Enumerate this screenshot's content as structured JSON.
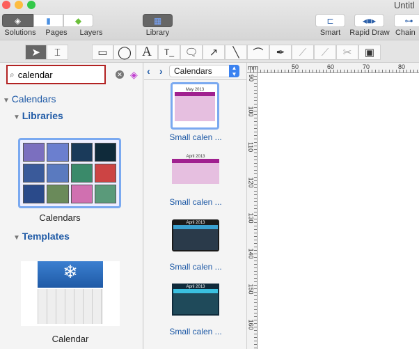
{
  "window": {
    "title": "Untitl"
  },
  "toolbar": {
    "solutions": "Solutions",
    "pages": "Pages",
    "layers": "Layers",
    "library": "Library",
    "smart": "Smart",
    "rapid_draw": "Rapid Draw",
    "chain": "Chain"
  },
  "search": {
    "value": "calendar"
  },
  "tree": {
    "root": "Calendars",
    "libraries": "Libraries",
    "library_item": "Calendars",
    "templates": "Templates",
    "template_item": "Calendar"
  },
  "library_panel": {
    "selected": "Calendars",
    "items": [
      {
        "label": "Small calen ...",
        "month": "May 2013",
        "theme": "#a0208f"
      },
      {
        "label": "Small calen ...",
        "month": "April 2013",
        "theme": "#a0208f"
      },
      {
        "label": "Small calen ...",
        "month": "April 2013",
        "theme": "#1a1a1a"
      },
      {
        "label": "Small calen ...",
        "month": "April 2013",
        "theme": "#0f2a3a"
      }
    ]
  },
  "ruler": {
    "unit": "mm",
    "h": [
      "50",
      "60",
      "70",
      "80"
    ],
    "v": [
      "90",
      "100",
      "110",
      "120",
      "130",
      "140",
      "150",
      "160"
    ]
  },
  "colors": {
    "accent": "#1f5aa6",
    "search_highlight": "#b22222"
  }
}
